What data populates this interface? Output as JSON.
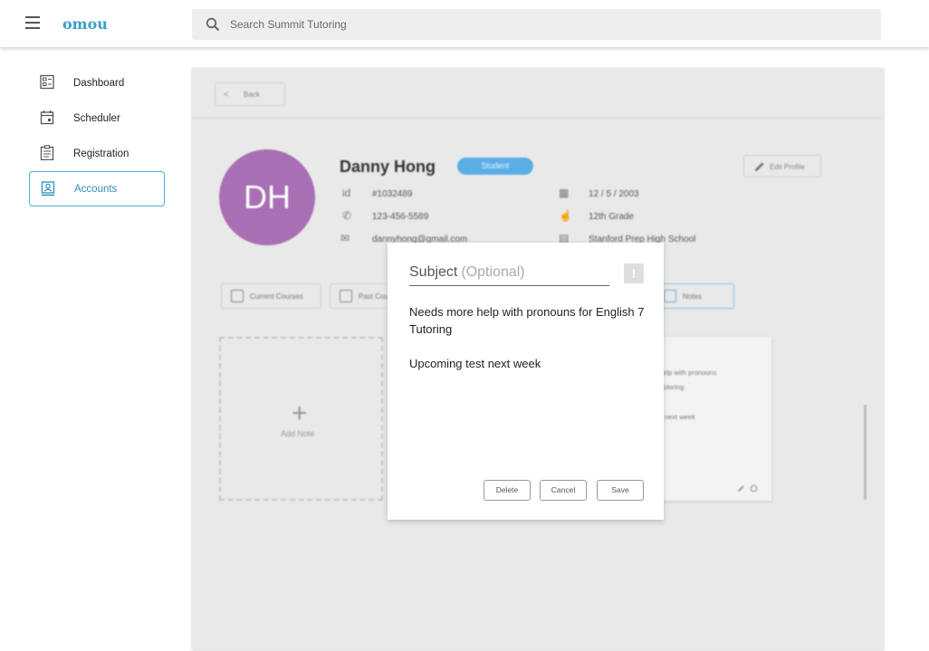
{
  "app": {
    "logo": "omou"
  },
  "search": {
    "placeholder": "Search Summit Tutoring"
  },
  "sidebar": {
    "items": [
      {
        "label": "Dashboard",
        "icon": "dashboard-icon"
      },
      {
        "label": "Scheduler",
        "icon": "calendar-icon"
      },
      {
        "label": "Registration",
        "icon": "clipboard-icon"
      },
      {
        "label": "Accounts",
        "icon": "account-icon",
        "active": true
      }
    ]
  },
  "profile": {
    "back_label": "Back",
    "initials": "DH",
    "name": "Danny Hong",
    "role_badge": "Student",
    "id_label": "id",
    "id": "#1032489",
    "phone": "123-456-5589",
    "email": "dannyhong@gmail.com",
    "birthday": "12 / 5 / 2003",
    "grade": "12th Grade",
    "school": "Stanford Prep High School",
    "edit_label": "Edit Profile",
    "tabs": [
      "Current Courses",
      "Past Courses",
      "Notes"
    ],
    "add_note_label": "Add Note",
    "note_preview_lines": [
      "e help with pronouns",
      "7 Tutoring",
      "est next week"
    ]
  },
  "modal": {
    "subject_placeholder": "Subject",
    "subject_optional": "(Optional)",
    "alert_symbol": "!",
    "body_line1": "Needs more help with pronouns for English 7",
    "body_line2": "Tutoring",
    "body_line3": "Upcoming test next week",
    "buttons": {
      "delete": "Delete",
      "cancel": "Cancel",
      "save": "Save"
    }
  },
  "colors": {
    "accent": "#4aaed6",
    "avatar": "#a96fb4",
    "badge": "#5aaee6"
  }
}
